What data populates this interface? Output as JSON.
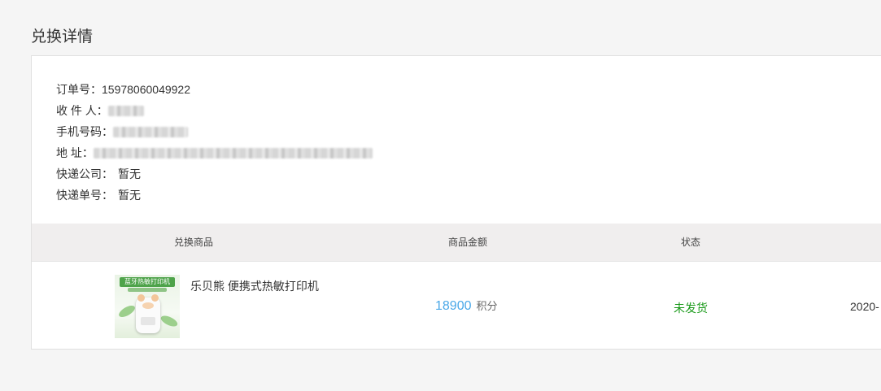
{
  "page": {
    "title": "兑换详情"
  },
  "order": {
    "order_no_label": "订单号：",
    "order_no": "15978060049922",
    "recipient_label": "收 件 人：",
    "phone_label": "手机号码：",
    "address_label": "地 址：",
    "courier_label": "快递公司：",
    "courier_value": "暂无",
    "tracking_label": "快递单号：",
    "tracking_value": "暂无"
  },
  "table": {
    "headers": [
      "兑换商品",
      "商品金额",
      "状态"
    ]
  },
  "item": {
    "image_banner": "蓝牙热敏打印机",
    "name": "乐贝熊 便携式热敏打印机",
    "amount": "18900",
    "amount_unit": "积分",
    "status": "未发货",
    "date": "2020-"
  },
  "colors": {
    "amount": "#4aa8e8",
    "status": "#1a9a1a",
    "header_bg": "#f0eeee",
    "page_bg": "#f5f5f5"
  }
}
